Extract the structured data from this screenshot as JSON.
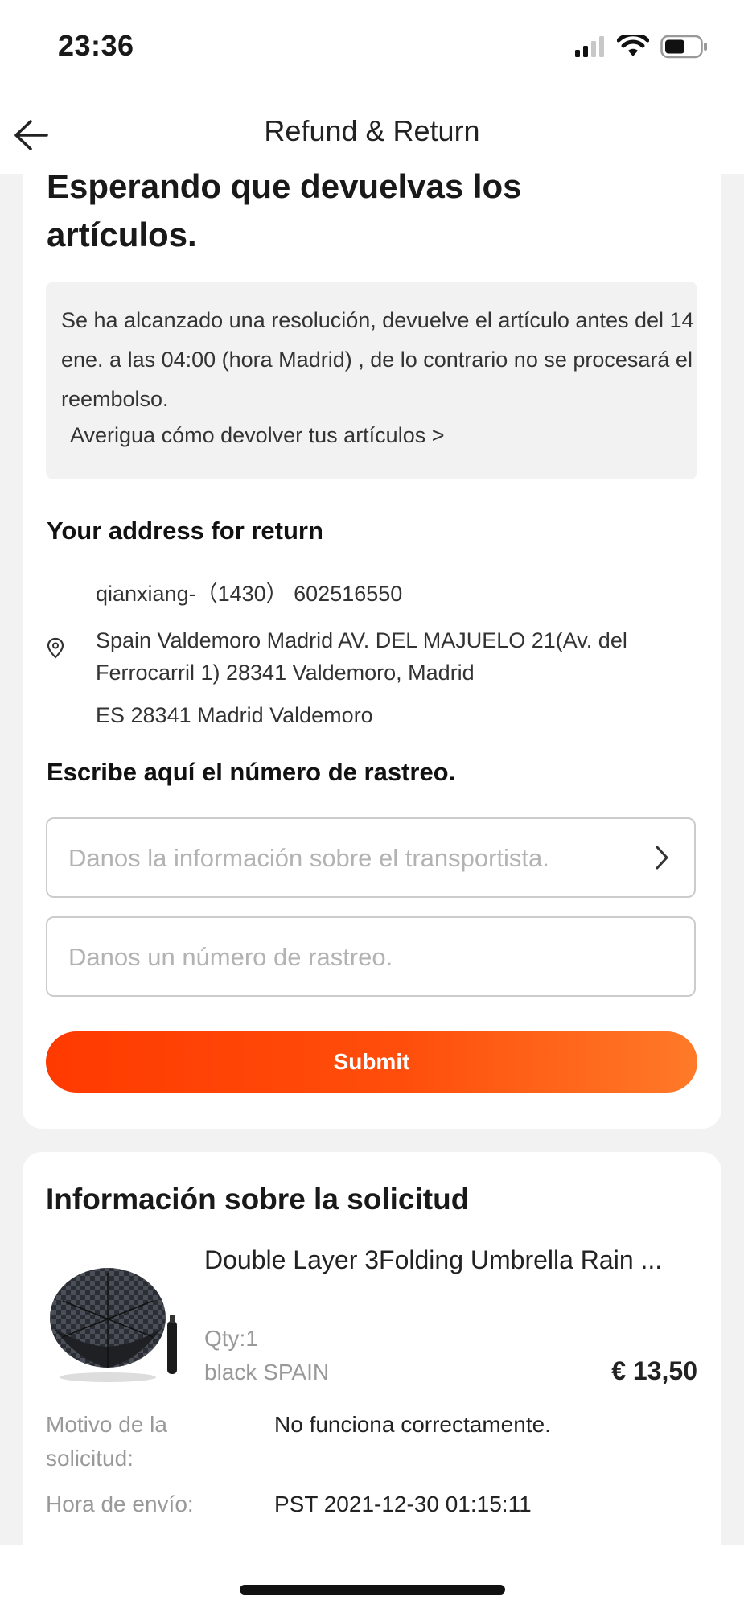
{
  "status_bar": {
    "time": "23:36"
  },
  "nav": {
    "title": "Refund & Return"
  },
  "status_section": {
    "title": "Esperando que devuelvas los artículos.",
    "notice_text": "Se ha alcanzado una resolución, devuelve el artículo antes del  14 ene. a las 04:00 (hora Madrid) , de lo contrario no se procesará el reembolso.",
    "notice_link": "Averigua cómo devolver tus artículos >"
  },
  "address": {
    "heading": "Your address for return",
    "contact": "qianxiang-（1430） 602516550",
    "street": "Spain Valdemoro Madrid AV. DEL MAJUELO 21(Av. del Ferrocarril 1) 28341 Valdemoro, Madrid",
    "region": "ES 28341 Madrid Valdemoro"
  },
  "tracking": {
    "heading": "Escribe aquí el número de rastreo.",
    "carrier_placeholder": "Danos la información sobre el transportista.",
    "number_placeholder": "Danos un número de rastreo.",
    "submit_label": "Submit"
  },
  "request_info": {
    "title": "Información sobre la solicitud",
    "product": {
      "name": "Double Layer 3Folding Umbrella Rain ...",
      "qty": "Qty:1",
      "variant": "black SPAIN",
      "price": "€ 13,50"
    },
    "rows": [
      {
        "label": "Motivo de la solicitud:",
        "value": "No funciona correctamente."
      },
      {
        "label": "Hora de envío:",
        "value": "PST 2021-12-30 01:15:11"
      }
    ]
  },
  "colors": {
    "accent_start": "#ff3a00",
    "accent_end": "#ff7a28",
    "background": "#f2f2f2"
  },
  "icons": [
    "back-arrow-icon",
    "signal-icon",
    "wifi-icon",
    "battery-icon",
    "location-pin-icon",
    "chevron-right-icon"
  ]
}
